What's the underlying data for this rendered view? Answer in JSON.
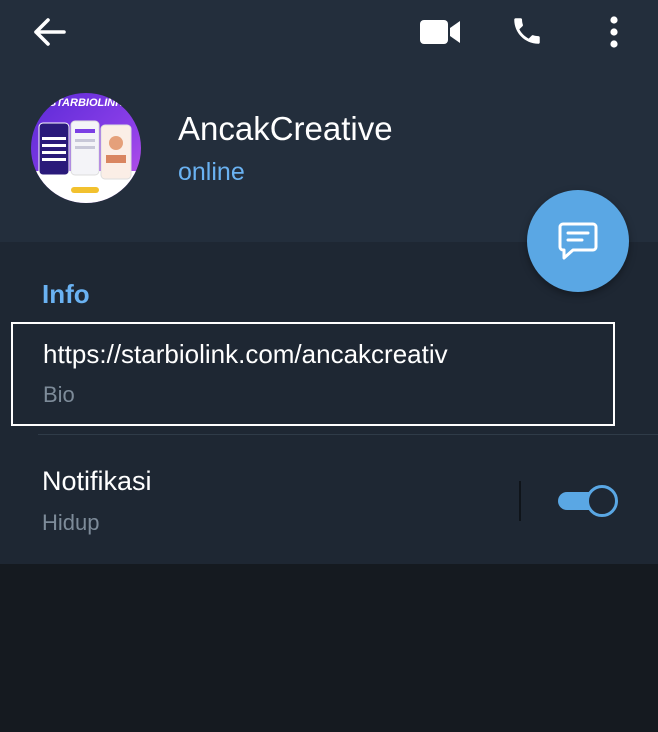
{
  "header": {
    "back_icon": "arrow-left-icon",
    "video_icon": "video-camera-icon",
    "call_icon": "phone-icon",
    "more_icon": "more-vertical-icon",
    "avatar_logo_text": "STARBIOLINK",
    "name": "AncakCreative",
    "status": "online",
    "fab_icon": "message-icon"
  },
  "info": {
    "title": "Info",
    "bio_value": "https://starbiolink.com/ancakcreativ",
    "bio_label": "Bio",
    "notifications_title": "Notifikasi",
    "notifications_status": "Hidup",
    "notifications_enabled": true
  },
  "colors": {
    "header_bg": "#232e3c",
    "section_bg": "#1e2733",
    "page_bg": "#151a20",
    "accent": "#6ab2f2",
    "fab": "#5aa7e4",
    "secondary_text": "#7d8b99"
  }
}
